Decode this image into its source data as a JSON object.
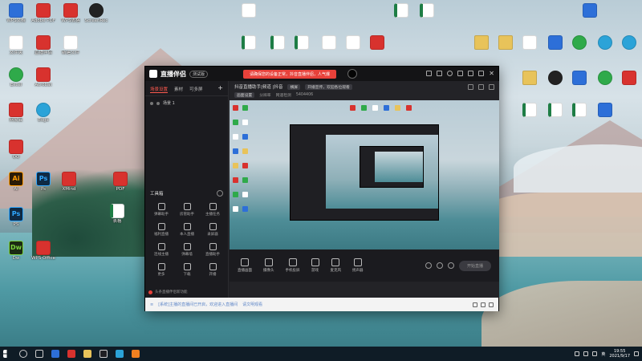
{
  "desktop": {
    "icons": [
      {
        "label": "WPS文档",
        "style": "blue"
      },
      {
        "label": "Adobe PDF",
        "style": "red"
      },
      {
        "label": "WPS表格",
        "style": "red"
      },
      {
        "label": "ScreenRec",
        "style": "dark"
      },
      {
        "label": "文件夹",
        "style": "doc"
      },
      {
        "label": "直播伴侣",
        "style": "red"
      },
      {
        "label": "新建文件",
        "style": "doc"
      },
      {
        "label": "Excel",
        "style": "green"
      },
      {
        "label": "Acrobat",
        "style": "red"
      },
      {
        "label": "网易云",
        "style": "red"
      },
      {
        "label": "Edge",
        "style": "cyan"
      },
      {
        "label": "QQ",
        "style": "red"
      },
      {
        "label": "Ai",
        "style": "ai",
        "glyph": "Ai"
      },
      {
        "label": "Ps",
        "style": "ps",
        "glyph": "Ps"
      },
      {
        "label": "XMind",
        "style": "red"
      },
      {
        "label": "PS",
        "style": "ps",
        "glyph": "Ps"
      },
      {
        "label": "Dw",
        "style": "dw",
        "glyph": "Dw"
      },
      {
        "label": "WPS Office",
        "style": "red"
      },
      {
        "label": "PDF",
        "style": "red"
      },
      {
        "label": "表格",
        "style": "xls"
      }
    ]
  },
  "app": {
    "title": "直播伴侣",
    "version": "测试版",
    "banner": "请确保您的设备正常，抖音直播伴侣，人气爆"
  },
  "leftpanel": {
    "tabs": [
      "场景设置",
      "素材",
      "可多屏"
    ],
    "add": "+",
    "scene": "场景 1",
    "tools_title": "工具箱",
    "tools": [
      {
        "label": "弹幕助手"
      },
      {
        "label": "房管助手"
      },
      {
        "label": "主播任务"
      },
      {
        "label": "福利直播"
      },
      {
        "label": "本人直播"
      },
      {
        "label": "录屏器"
      },
      {
        "label": "连线主播"
      },
      {
        "label": "弹幕墙"
      },
      {
        "label": "直播助手"
      },
      {
        "label": "更多"
      },
      {
        "label": "下载"
      },
      {
        "label": "开播"
      }
    ],
    "footer": "头条直播伴侣新功能"
  },
  "rightpanel": {
    "stream_title": "抖音直播助手|频道 |抖音",
    "tag1": "横屏",
    "tag2": "开播宣传，欢迎各位观看",
    "row2": [
      "画面设置",
      "分辨率",
      "网速检测",
      "5404406"
    ],
    "controls": [
      {
        "label": "直播画面"
      },
      {
        "label": "摄像头"
      },
      {
        "label": "手机投屏"
      },
      {
        "label": "游戏"
      },
      {
        "label": "麦克风"
      },
      {
        "label": "扬声器"
      }
    ],
    "start_button": "开始直播"
  },
  "chatbar": {
    "text": "[系统]主播的直播间已开启，欢迎进入直播间",
    "text2": "请文明观看"
  },
  "taskbar": {
    "time": "19:55",
    "date": "2021/9/17",
    "lang": "英"
  }
}
